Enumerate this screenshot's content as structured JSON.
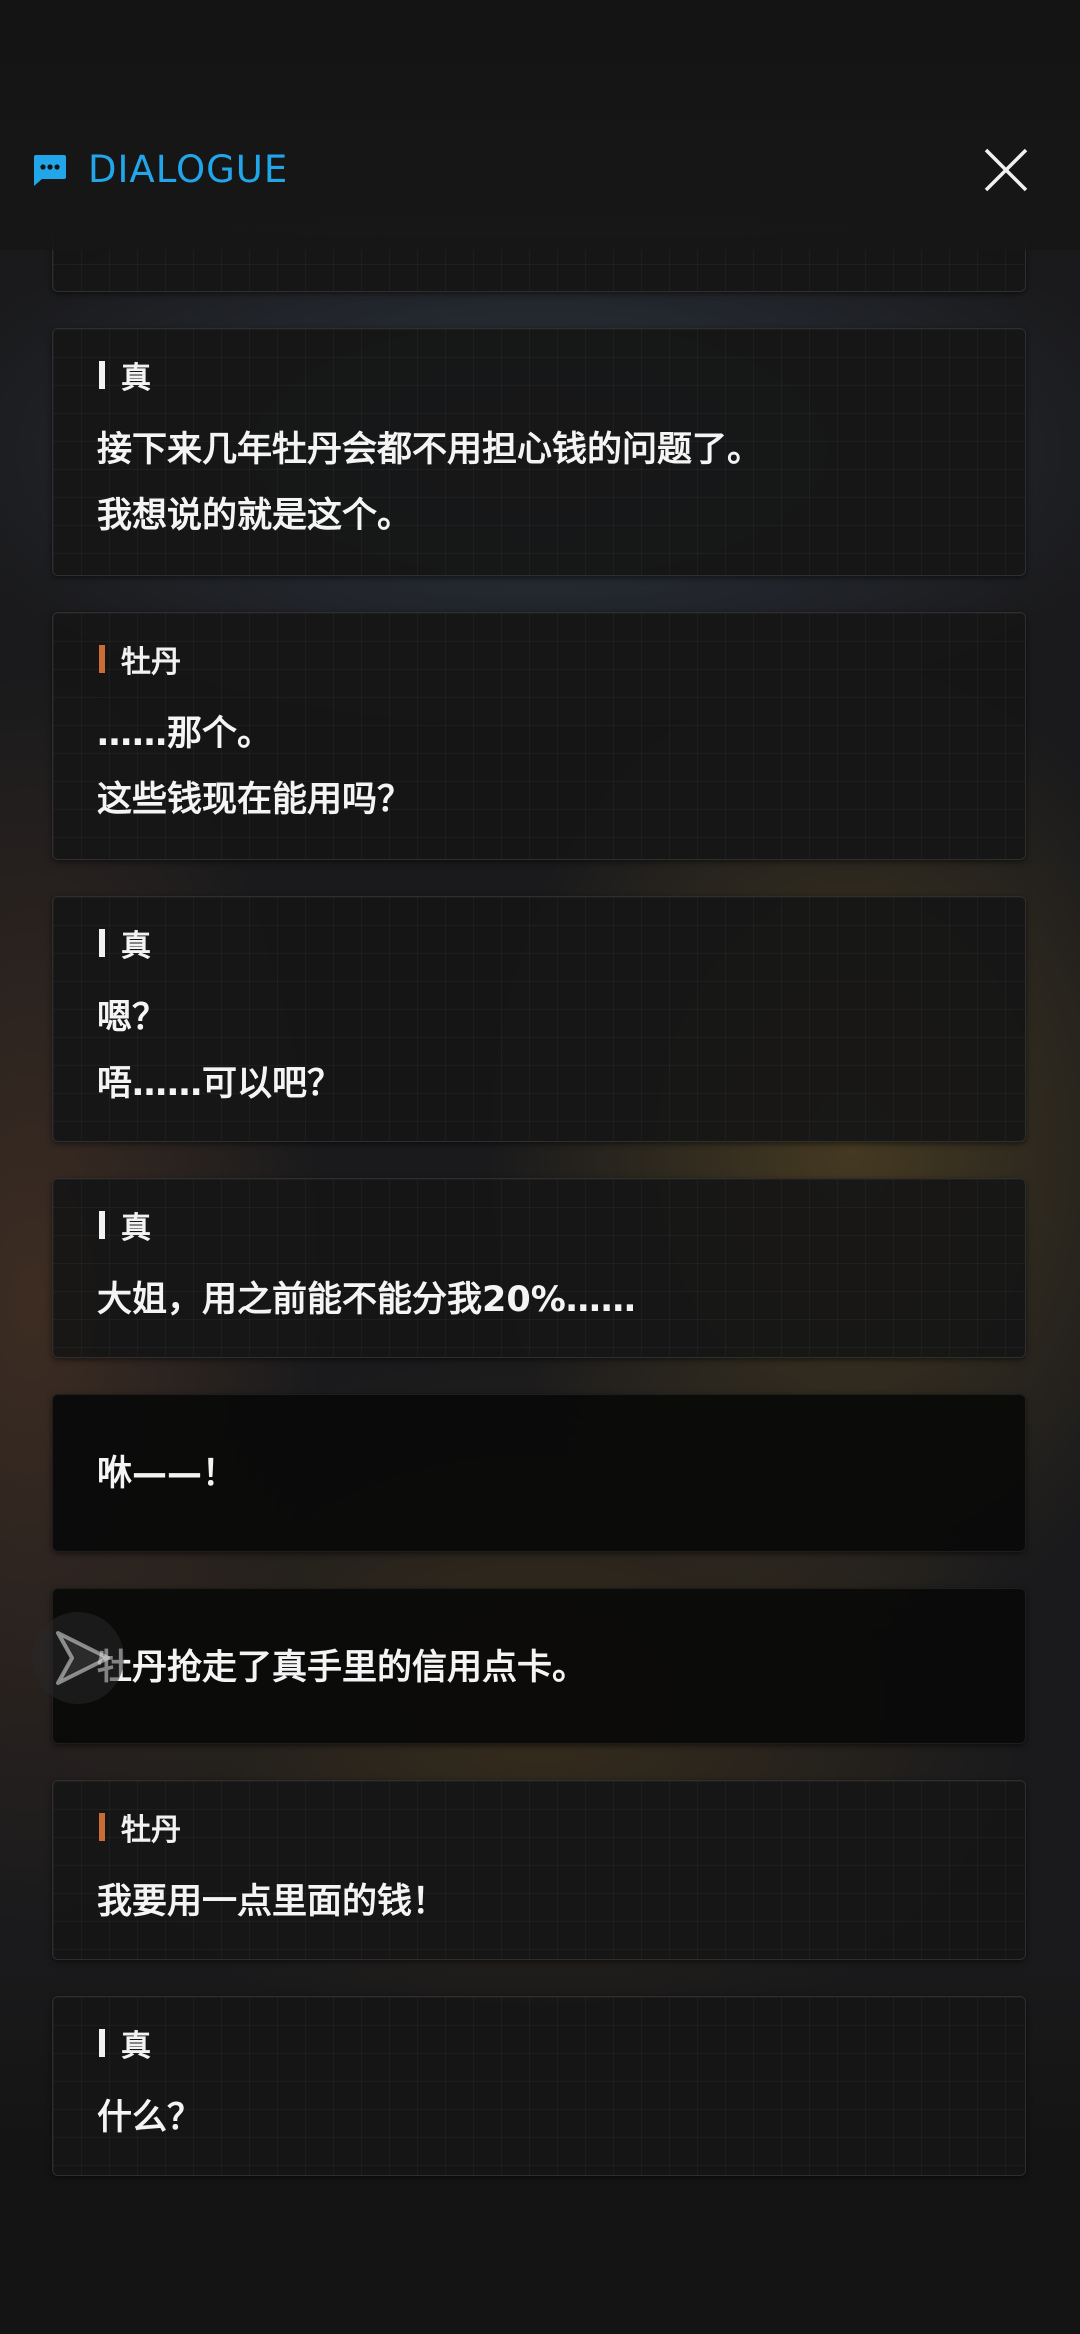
{
  "header": {
    "title": "DIALOGUE",
    "accent_color": "#22a6ea",
    "icon": "chat-bubble-icon",
    "close_icon": "close-icon"
  },
  "colors": {
    "speaker_zhen": "#f2f2f2",
    "speaker_peony": "#c96d34"
  },
  "dialogue": [
    {
      "speaker": "真",
      "lines": [
        "接下来几年牡丹会都不用担心钱的问题了。",
        "我想说的就是这个。"
      ]
    },
    {
      "speaker": "牡丹",
      "lines": [
        "……那个。",
        "这些钱现在能用吗？"
      ]
    },
    {
      "speaker": "真",
      "lines": [
        "嗯？",
        "唔……可以吧？"
      ]
    },
    {
      "speaker": "真",
      "lines": [
        "大姐，用之前能不能分我20%……"
      ]
    },
    {
      "speaker": "",
      "lines": [
        "咻——！"
      ]
    },
    {
      "speaker": "",
      "lines": [
        "牡丹抢走了真手里的信用点卡。"
      ]
    },
    {
      "speaker": "牡丹",
      "lines": [
        "我要用一点里面的钱！"
      ]
    },
    {
      "speaker": "真",
      "lines": [
        "什么？"
      ]
    }
  ],
  "auto_play_icon": "play-arrow-icon"
}
